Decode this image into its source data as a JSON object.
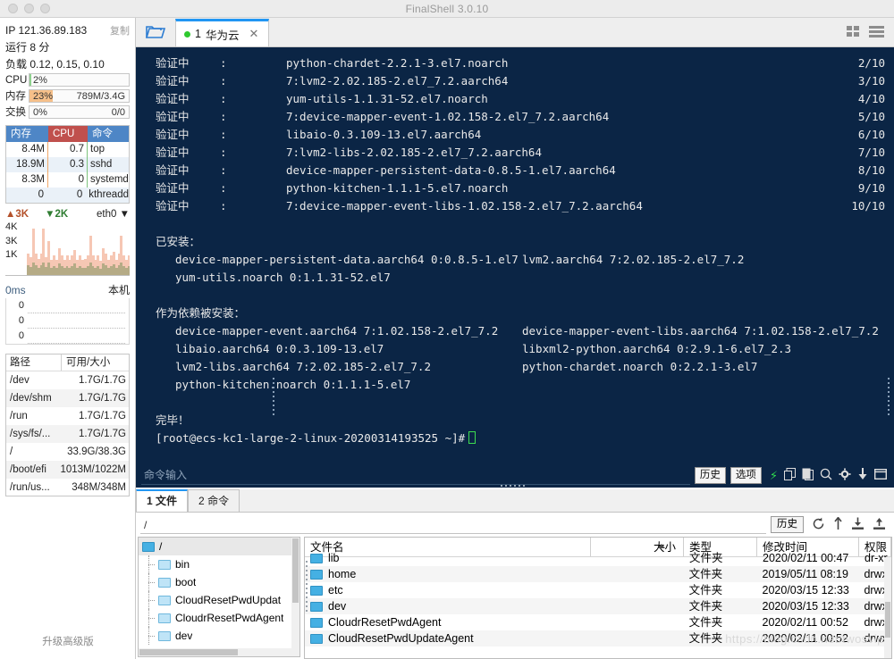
{
  "window": {
    "title": "FinalShell 3.0.10"
  },
  "server_panel": {
    "ip_label": "IP 121.36.89.183",
    "copy_label": "复制",
    "uptime": "运行 8 分",
    "load": "负载 0.12, 0.15, 0.10",
    "meters": [
      {
        "label": "CPU",
        "percent_text": "2%",
        "percent": 2,
        "detail": "",
        "color": "#8fd18f"
      },
      {
        "label": "内存",
        "percent_text": "23%",
        "percent": 23,
        "detail": "789M/3.4G",
        "color": "#f6c08a"
      },
      {
        "label": "交换",
        "percent_text": "0%",
        "percent": 0,
        "detail": "0/0",
        "color": "#cccccc"
      }
    ],
    "process_table": {
      "headers": [
        "内存",
        "CPU",
        "命令"
      ],
      "rows": [
        {
          "mem": "8.4M",
          "cpu": "0.7",
          "cmd": "top"
        },
        {
          "mem": "18.9M",
          "cpu": "0.3",
          "cmd": "sshd"
        },
        {
          "mem": "8.3M",
          "cpu": "0",
          "cmd": "systemd"
        },
        {
          "mem": "0",
          "cpu": "0",
          "cmd": "kthreadd"
        }
      ]
    },
    "network": {
      "upload": "3K",
      "download": "2K",
      "interface": "eth0",
      "y_ticks": [
        "4K",
        "3K",
        "1K"
      ]
    },
    "latency": {
      "unit": "0ms",
      "target": "本机",
      "y_ticks": [
        "0",
        "0",
        "0"
      ]
    },
    "disk_table": {
      "headers": [
        "路径",
        "可用/大小"
      ],
      "rows": [
        {
          "path": "/dev",
          "size": "1.7G/1.7G"
        },
        {
          "path": "/dev/shm",
          "size": "1.7G/1.7G"
        },
        {
          "path": "/run",
          "size": "1.7G/1.7G"
        },
        {
          "path": "/sys/fs/...",
          "size": "1.7G/1.7G"
        },
        {
          "path": "/",
          "size": "33.9G/38.3G"
        },
        {
          "path": "/boot/efi",
          "size": "1013M/1022M"
        },
        {
          "path": "/run/us...",
          "size": "348M/348M"
        }
      ]
    },
    "upgrade_label": "升级高级版"
  },
  "tabbar": {
    "folder_icon": "open-folder-icon",
    "tab": {
      "index": "1",
      "name": "华为云",
      "close": "✕"
    },
    "view_grid_icon": "grid-view-icon",
    "view_list_icon": "list-view-icon"
  },
  "terminal": {
    "verify_label": "验证中",
    "colon": ":",
    "verify_rows": [
      {
        "pkg": "python-chardet-2.2.1-3.el7.noarch",
        "count": "2/10"
      },
      {
        "pkg": "7:lvm2-2.02.185-2.el7_7.2.aarch64",
        "count": "3/10"
      },
      {
        "pkg": "yum-utils-1.1.31-52.el7.noarch",
        "count": "4/10"
      },
      {
        "pkg": "7:device-mapper-event-1.02.158-2.el7_7.2.aarch64",
        "count": "5/10"
      },
      {
        "pkg": "libaio-0.3.109-13.el7.aarch64",
        "count": "6/10"
      },
      {
        "pkg": "7:lvm2-libs-2.02.185-2.el7_7.2.aarch64",
        "count": "7/10"
      },
      {
        "pkg": "device-mapper-persistent-data-0.8.5-1.el7.aarch64",
        "count": "8/10"
      },
      {
        "pkg": "python-kitchen-1.1.1-5.el7.noarch",
        "count": "9/10"
      },
      {
        "pkg": "7:device-mapper-event-libs-1.02.158-2.el7_7.2.aarch64",
        "count": "10/10"
      }
    ],
    "installed_header": "已安装：",
    "installed_rows": [
      {
        "left": "device-mapper-persistent-data.aarch64 0:0.8.5-1.el7",
        "right": "lvm2.aarch64 7:2.02.185-2.el7_7.2"
      },
      {
        "left": "yum-utils.noarch 0:1.1.31-52.el7",
        "right": ""
      }
    ],
    "dependency_header": "作为依赖被安装：",
    "dependency_rows": [
      {
        "left": "device-mapper-event.aarch64 7:1.02.158-2.el7_7.2",
        "right": "device-mapper-event-libs.aarch64 7:1.02.158-2.el7_7.2"
      },
      {
        "left": "libaio.aarch64 0:0.3.109-13.el7",
        "right": "libxml2-python.aarch64 0:2.9.1-6.el7_2.3"
      },
      {
        "left": "lvm2-libs.aarch64 7:2.02.185-2.el7_7.2",
        "right": "python-chardet.noarch 0:2.2.1-3.el7"
      },
      {
        "left": "python-kitchen.noarch 0:1.1.1-5.el7",
        "right": ""
      }
    ],
    "done_label": "完毕！",
    "prompt": "[root@ecs-kc1-large-2-linux-20200314193525 ~]#"
  },
  "command_bar": {
    "placeholder": "命令输入",
    "history_label": "历史",
    "options_label": "选项",
    "icons": [
      "lightning-icon",
      "copy-icon",
      "paste-icon",
      "search-icon",
      "gear-icon",
      "download-icon",
      "window-icon"
    ]
  },
  "bottom_tabs": [
    {
      "index": "1",
      "label": "文件",
      "active": true
    },
    {
      "index": "2",
      "label": "命令",
      "active": false
    }
  ],
  "path_bar": {
    "value": "/",
    "history_label": "历史",
    "icons": [
      "refresh-icon",
      "upload-arrow-icon",
      "download-file-icon",
      "upload-file-icon"
    ]
  },
  "tree": {
    "root": "/",
    "items": [
      "bin",
      "boot",
      "CloudResetPwdUpdat",
      "CloudrResetPwdAgent",
      "dev"
    ]
  },
  "file_list": {
    "headers": [
      "文件名",
      "大小",
      "类型",
      "修改时间",
      "权限"
    ],
    "rows": [
      {
        "name": "lib",
        "size": "",
        "type": "文件夹",
        "time": "2020/02/11 00:47",
        "perm": "dr-xr"
      },
      {
        "name": "home",
        "size": "",
        "type": "文件夹",
        "time": "2019/05/11 08:19",
        "perm": "drwxr"
      },
      {
        "name": "etc",
        "size": "",
        "type": "文件夹",
        "time": "2020/03/15 12:33",
        "perm": "drwxr"
      },
      {
        "name": "dev",
        "size": "",
        "type": "文件夹",
        "time": "2020/03/15 12:33",
        "perm": "drwxr"
      },
      {
        "name": "CloudrResetPwdAgent",
        "size": "",
        "type": "文件夹",
        "time": "2020/02/11 00:52",
        "perm": "drwxr"
      },
      {
        "name": "CloudResetPwdUpdateAgent",
        "size": "",
        "type": "文件夹",
        "time": "2020/02/11 00:52",
        "perm": "drwxr"
      }
    ],
    "watermark": "https://blog.csdn.net/twosvip"
  }
}
